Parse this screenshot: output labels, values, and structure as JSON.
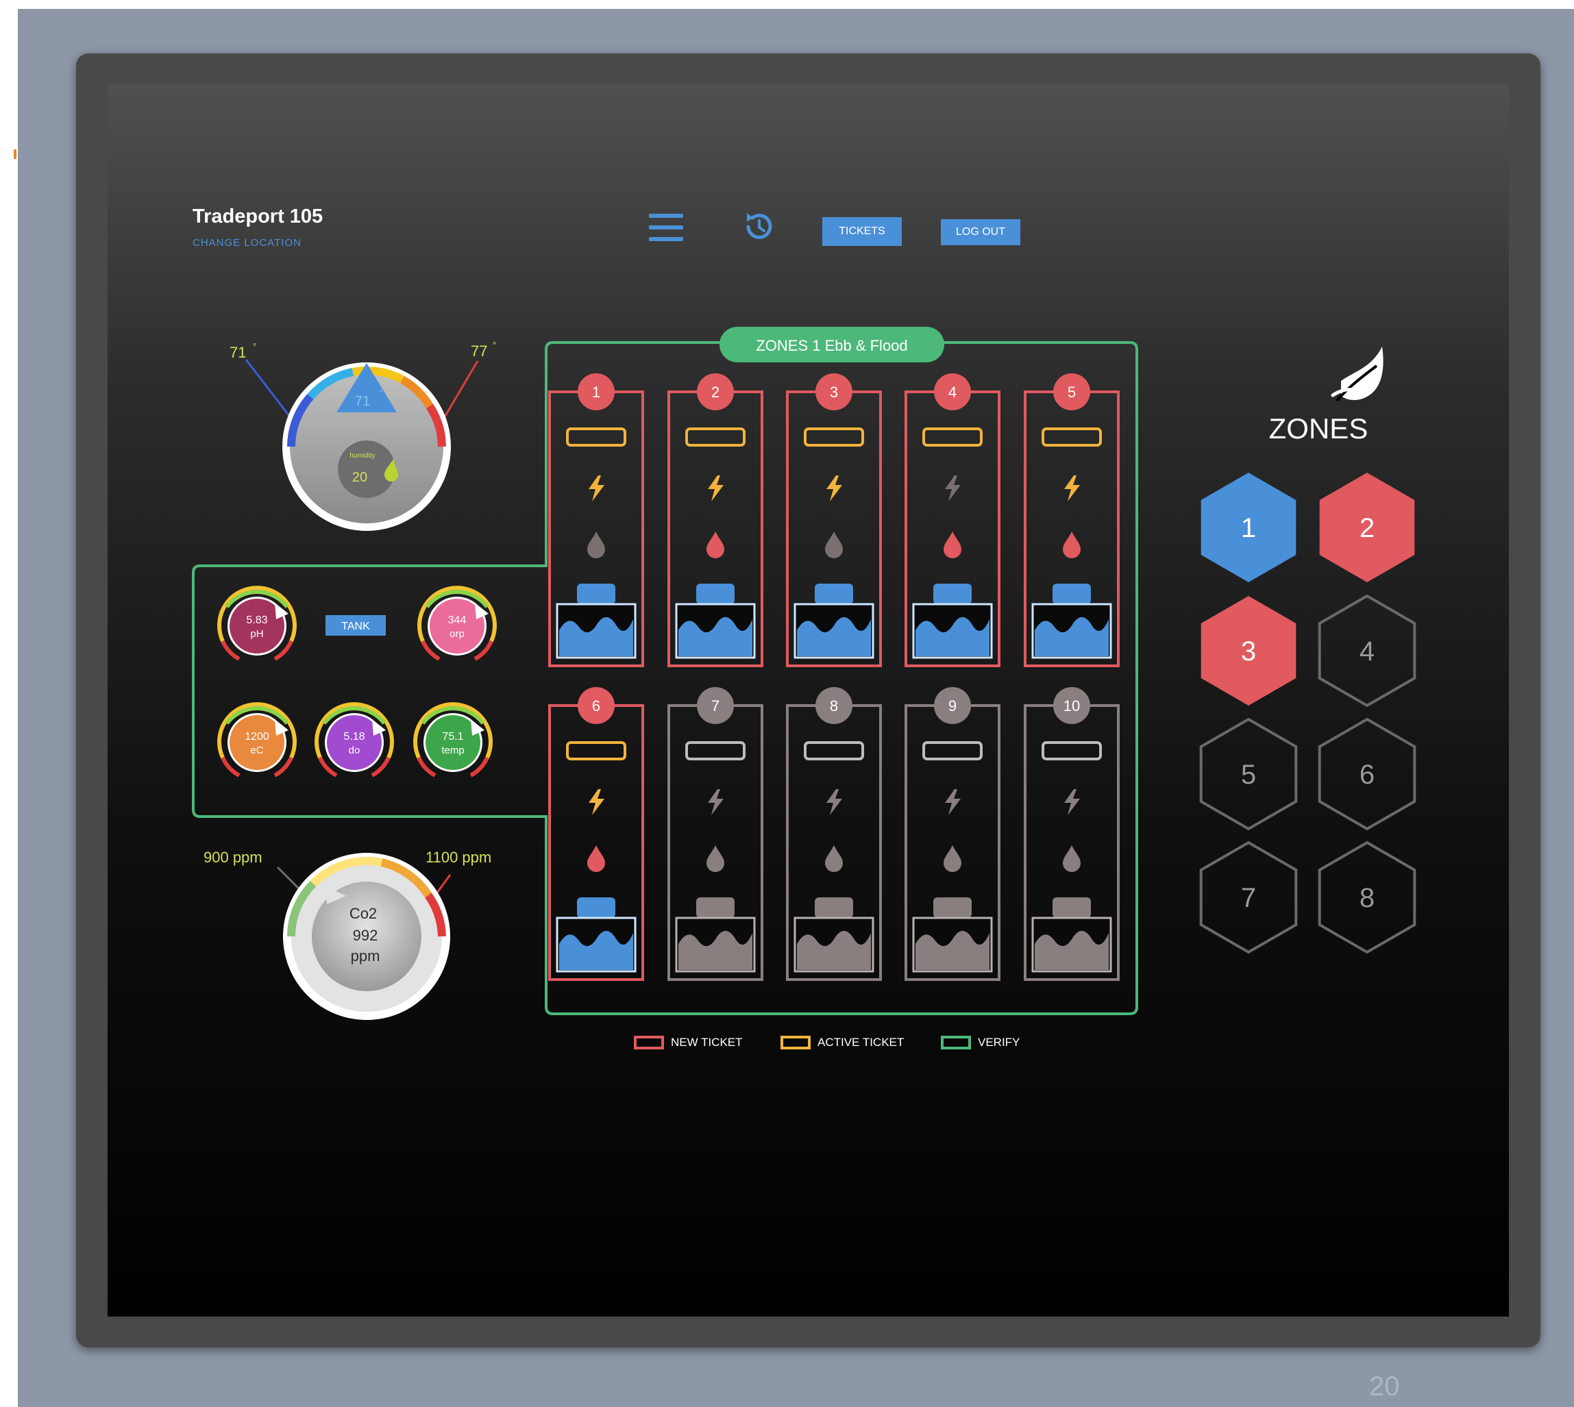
{
  "header": {
    "location_name": "Tradeport 105",
    "change_location": "CHANGE LOCATION",
    "tickets_label": "TICKETS",
    "logout_label": "LOG OUT"
  },
  "temperature_gauge": {
    "low_label": "71",
    "high_label": "77",
    "current": "71",
    "humidity_label": "humidity",
    "humidity_value": "20"
  },
  "tank": {
    "label": "TANK",
    "sensors": [
      {
        "value": "5.83",
        "unit": "pH",
        "color": "#a3345e"
      },
      {
        "value": "344",
        "unit": "orp",
        "color": "#ea6c9a"
      },
      {
        "value": "1200",
        "unit": "eC",
        "color": "#e8893e"
      },
      {
        "value": "5.18",
        "unit": "do",
        "color": "#a04bd0"
      },
      {
        "value": "75.1",
        "unit": "temp",
        "color": "#3ea64a"
      }
    ]
  },
  "co2_gauge": {
    "low_label": "900 ppm",
    "high_label": "1100 ppm",
    "line1": "Co2",
    "line2": "992",
    "line3": "ppm"
  },
  "zone_panel": {
    "title": "ZONES 1 Ebb & Flood",
    "benches": [
      {
        "number": "1",
        "state": "active"
      },
      {
        "number": "2",
        "state": "active"
      },
      {
        "number": "3",
        "state": "active"
      },
      {
        "number": "4",
        "state": "active"
      },
      {
        "number": "5",
        "state": "active"
      },
      {
        "number": "6",
        "state": "active"
      },
      {
        "number": "7",
        "state": "inactive"
      },
      {
        "number": "8",
        "state": "inactive"
      },
      {
        "number": "9",
        "state": "inactive"
      },
      {
        "number": "10",
        "state": "inactive"
      }
    ]
  },
  "legend": {
    "new_ticket": "NEW TICKET",
    "active_ticket": "ACTIVE TICKET",
    "verify": "VERIFY"
  },
  "zones_nav": {
    "title": "ZONES",
    "hexes": [
      "1",
      "2",
      "3",
      "4",
      "5",
      "6",
      "7",
      "8"
    ]
  },
  "slide": {
    "page_number": "20"
  },
  "colors": {
    "blue": "#4a90d9",
    "red": "#e05a5f",
    "green": "#4cb87a",
    "yellow": "#f2b33d",
    "gray": "#8a7f7f"
  }
}
